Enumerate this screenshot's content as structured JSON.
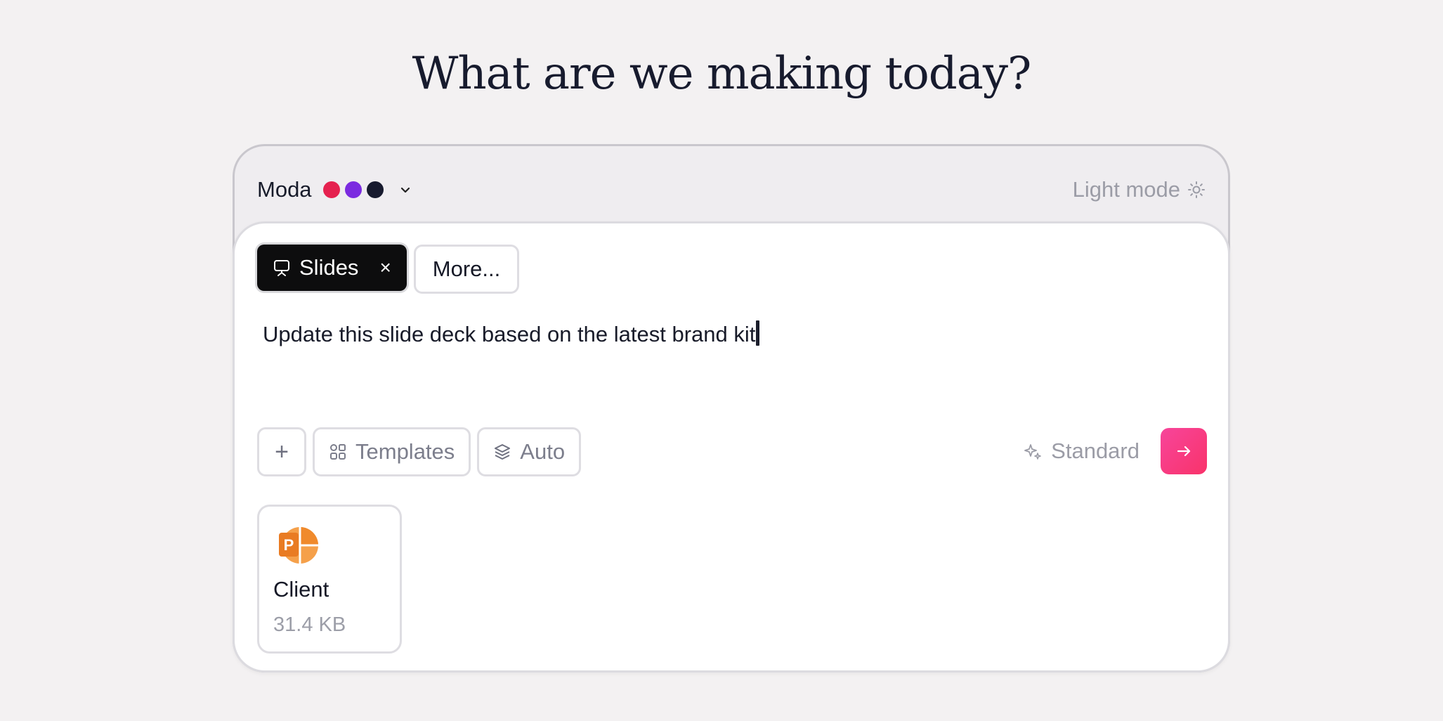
{
  "page": {
    "title": "What are we making today?"
  },
  "theme": {
    "name": "Moda",
    "swatches": [
      "#e5214f",
      "#7b2be0",
      "#171a2e"
    ],
    "mode_label": "Light mode"
  },
  "chips": {
    "active": {
      "label": "Slides",
      "icon": "presentation-icon",
      "remove": "×"
    },
    "more_label": "More..."
  },
  "prompt": {
    "value": "Update this slide deck based on the latest brand kit"
  },
  "toolbar": {
    "add_label": "+",
    "templates_label": "Templates",
    "auto_label": "Auto",
    "standard_label": "Standard"
  },
  "attachment": {
    "icon": "powerpoint-icon",
    "name": "Client",
    "size": "31.4 KB"
  },
  "colors": {
    "accent": "#f8407f",
    "ppt": "#f28a2e"
  }
}
